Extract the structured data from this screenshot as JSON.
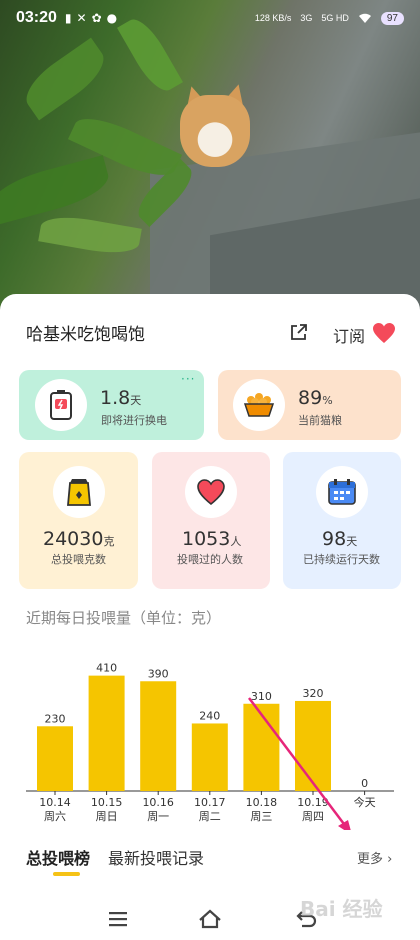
{
  "status_bar": {
    "time": "03:20",
    "net_speed": "128 KB/s",
    "signal1": "3G",
    "signal2": "5G HD",
    "battery": "97"
  },
  "device": {
    "title": "哈基米吃饱喝饱",
    "subscribe_label": "订阅",
    "accent": "#f44a5a"
  },
  "cards": [
    {
      "value": "1.8",
      "unit": "天",
      "label": "即将进行换电",
      "color": "#bff0dc"
    },
    {
      "value": "89",
      "unit": "%",
      "label": "当前猫粮",
      "color": "#fde2cc"
    },
    {
      "value": "24030",
      "unit": "克",
      "label": "总投喂克数",
      "color": "#fff1d4"
    },
    {
      "value": "1053",
      "unit": "人",
      "label": "投喂过的人数",
      "color": "#fde6e6"
    },
    {
      "value": "98",
      "unit": "天",
      "label": "已持续运行天数",
      "color": "#e6f0ff"
    }
  ],
  "section_title": "近期每日投喂量（单位：克）",
  "chart_data": {
    "type": "bar",
    "categories": [
      "10.14 周六",
      "10.15 周日",
      "10.16 周一",
      "10.17 周二",
      "10.18 周三",
      "10.19 周四",
      "今天"
    ],
    "dates": [
      "10.14",
      "10.15",
      "10.16",
      "10.17",
      "10.18",
      "10.19",
      ""
    ],
    "weekdays": [
      "周六",
      "周日",
      "周一",
      "周二",
      "周三",
      "周四",
      "今天"
    ],
    "values": [
      230,
      410,
      390,
      240,
      310,
      320,
      0
    ],
    "ylim": [
      0,
      430
    ],
    "bar_color": "#f5c500",
    "title": "",
    "xlabel": "",
    "ylabel": ""
  },
  "tabs": {
    "tab1": "总投喂榜",
    "tab2": "最新投喂记录",
    "more": "更多"
  },
  "watermark": "Bai 经验"
}
